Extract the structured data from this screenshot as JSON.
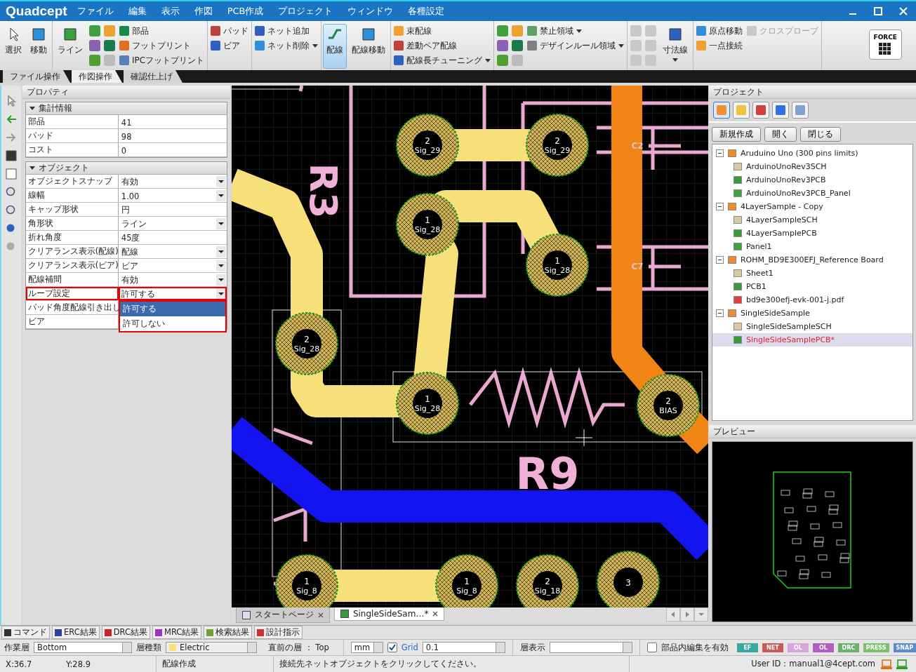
{
  "app": {
    "logo": "Quadcept",
    "menu": [
      "ファイル",
      "編集",
      "表示",
      "作図",
      "PCB作成",
      "プロジェクト",
      "ウィンドウ",
      "各種設定"
    ]
  },
  "ribbon": {
    "groups": [
      {
        "items": [
          {
            "kind": "big",
            "label": "選択",
            "selected": false
          },
          {
            "kind": "big",
            "label": "移動",
            "selected": false
          }
        ]
      },
      {
        "items": [
          {
            "kind": "big",
            "label": "ライン",
            "selected": false
          },
          {
            "kind": "icons"
          },
          {
            "kind": "stack",
            "buttons": [
              {
                "label": "部品",
                "disabled": false
              },
              {
                "label": "フットプリント",
                "disabled": false
              },
              {
                "label": "IPCフットプリント",
                "disabled": false
              }
            ]
          }
        ]
      },
      {
        "items": [
          {
            "kind": "stack",
            "buttons": [
              {
                "label": "パッド",
                "disabled": false
              },
              {
                "label": "ビア",
                "disabled": false
              }
            ]
          }
        ]
      },
      {
        "items": [
          {
            "kind": "stack",
            "buttons": [
              {
                "label": "ネット追加",
                "disabled": false
              },
              {
                "label": "ネット削除",
                "dropdown": true,
                "disabled": false
              }
            ]
          }
        ]
      },
      {
        "items": [
          {
            "kind": "big",
            "label": "配線",
            "selected": true
          },
          {
            "kind": "big",
            "label": "配線移動",
            "selected": false
          }
        ]
      },
      {
        "items": [
          {
            "kind": "stack",
            "buttons": [
              {
                "label": "束配線",
                "disabled": false
              },
              {
                "label": "差動ペア配線",
                "disabled": false
              },
              {
                "label": "配線長チューニング",
                "dropdown": true,
                "disabled": false
              }
            ]
          }
        ]
      },
      {
        "items": [
          {
            "kind": "icons"
          },
          {
            "kind": "stack",
            "buttons": [
              {
                "label": "禁止領域",
                "dropdown": true,
                "disabled": false
              },
              {
                "label": "デザインルール領域",
                "dropdown": true,
                "disabled": false
              }
            ]
          }
        ]
      },
      {
        "items": [
          {
            "kind": "icons"
          },
          {
            "kind": "big",
            "label": "寸法線",
            "selected": false,
            "dropdown": true
          }
        ]
      },
      {
        "items": [
          {
            "kind": "stack",
            "buttons": [
              {
                "label": "原点移動",
                "disabled": false
              },
              {
                "label": "一点接続",
                "disabled": false
              }
            ]
          },
          {
            "kind": "stack",
            "buttons": [
              {
                "label": "クロスプローブ",
                "disabled": true
              }
            ]
          }
        ]
      },
      {
        "items": [
          {
            "kind": "force",
            "label": "FORCE"
          }
        ]
      }
    ]
  },
  "ribbon_tabs": [
    {
      "label": "ファイル操作",
      "selected": false
    },
    {
      "label": "作図操作",
      "selected": true
    },
    {
      "label": "確認仕上げ",
      "selected": false
    }
  ],
  "properties": {
    "title": "プロパティ",
    "sections": [
      {
        "title": "集計情報",
        "expanded": true,
        "rows": [
          {
            "label": "部品",
            "value": "41",
            "highlighted": false
          },
          {
            "label": "パッド",
            "value": "98",
            "highlighted": false
          },
          {
            "label": "コスト",
            "value": "0",
            "highlighted": false
          }
        ]
      },
      {
        "title": "オブジェクト",
        "expanded": true,
        "rows": [
          {
            "label": "オブジェクトスナップ",
            "value": "有効",
            "dropdown": true,
            "highlighted": false
          },
          {
            "label": "線幅",
            "value": "1.00",
            "dropdown": true,
            "highlighted": false
          },
          {
            "label": "キャップ形状",
            "value": "円",
            "highlighted": false
          },
          {
            "label": "角形状",
            "value": "ライン",
            "dropdown": true,
            "highlighted": false
          },
          {
            "label": "折れ角度",
            "value": "45度",
            "highlighted": false
          },
          {
            "label": "クリアランス表示(配線)",
            "value": "配線",
            "dropdown": true,
            "highlighted": false
          },
          {
            "label": "クリアランス表示(ビア)",
            "value": "ビア",
            "dropdown": true,
            "highlighted": false
          },
          {
            "label": "配線補間",
            "value": "有効",
            "dropdown": true,
            "highlighted": false
          },
          {
            "label": "ループ設定",
            "value": "許可する",
            "dropdown": true,
            "highlighted": true,
            "options": [
              {
                "label": "許可する",
                "selected": true
              },
              {
                "label": "許可しない",
                "selected": false
              }
            ]
          },
          {
            "label": "パッド角度配線引き出し",
            "highlighted": false
          },
          {
            "label": "ビア",
            "highlighted": false
          }
        ]
      }
    ]
  },
  "canvas": {
    "pads": [
      {
        "number": "2",
        "net": "Sig_29"
      },
      {
        "number": "2",
        "net": "Sig_29"
      },
      {
        "number": "1",
        "net": "Sig_28"
      },
      {
        "number": "1",
        "net": "Sig_28"
      },
      {
        "number": "2",
        "net": "Sig_28"
      },
      {
        "number": "1",
        "net": "Sig_28"
      },
      {
        "number": "2",
        "net": "BIAS"
      },
      {
        "number": "1",
        "net": "Sig_8"
      },
      {
        "number": "1",
        "net": "Sig_8"
      },
      {
        "number": "2",
        "net": "Sig_18"
      },
      {
        "number": "3"
      }
    ],
    "silk_labels": [
      "C2",
      "C7",
      "R9",
      "R3"
    ]
  },
  "doc_tabs": [
    {
      "label": "スタートページ",
      "selected": false
    },
    {
      "label": "SingleSideSam…*",
      "selected": true
    }
  ],
  "project": {
    "title": "プロジェクト",
    "buttons": [
      "新規作成",
      "開く",
      "閉じる"
    ],
    "tree": [
      {
        "kind": "prj",
        "label": "Aruduino Uno (300 pins limits)",
        "expanded": true,
        "selected": false,
        "children": [
          {
            "kind": "sch",
            "label": "ArduinoUnoRev3SCH",
            "selected": false
          },
          {
            "kind": "pcb",
            "label": "ArduinoUnoRev3PCB",
            "selected": false
          },
          {
            "kind": "panel",
            "label": "ArduinoUnoRev3PCB_Panel",
            "selected": false
          }
        ]
      },
      {
        "kind": "prj",
        "label": "4LayerSample - Copy",
        "expanded": true,
        "selected": false,
        "children": [
          {
            "kind": "sch",
            "label": "4LayerSampleSCH",
            "selected": false
          },
          {
            "kind": "pcb",
            "label": "4LayerSamplePCB",
            "selected": false
          },
          {
            "kind": "panel",
            "label": "Panel1",
            "selected": false
          }
        ]
      },
      {
        "kind": "prj",
        "label": "ROHM_BD9E300EFJ_Reference Board",
        "expanded": true,
        "selected": false,
        "children": [
          {
            "kind": "sch",
            "label": "Sheet1",
            "selected": false
          },
          {
            "kind": "pcb",
            "label": "PCB1",
            "selected": false
          },
          {
            "kind": "pdf",
            "label": "bd9e300efj-evk-001-j.pdf",
            "selected": false
          }
        ]
      },
      {
        "kind": "prj",
        "label": "SingleSideSample",
        "expanded": true,
        "selected": false,
        "children": [
          {
            "kind": "sch",
            "label": "SingleSideSampleSCH",
            "selected": false
          },
          {
            "kind": "pcb",
            "label": "SingleSideSamplePCB*",
            "selected": true
          }
        ]
      }
    ]
  },
  "preview": {
    "title": "プレビュー"
  },
  "bottom_tabs": [
    "コマンド",
    "ERC結果",
    "DRC結果",
    "MRC結果",
    "検索結果",
    "設計指示"
  ],
  "work_bar": {
    "work_layer_label": "作業層",
    "work_layer": "Bottom",
    "layer_type_label": "層種類",
    "layer_type": "Electric",
    "previous_layer": "直前の層 ： Top",
    "unit": "mm",
    "grid_label": "Grid",
    "grid_checked": true,
    "grid_value": "0.1",
    "layer_view_label": "層表示",
    "part_edit_label": "部品内編集を有効",
    "part_edit_checked": false,
    "badges": [
      {
        "label": "EF",
        "color": "#3aa7a0"
      },
      {
        "label": "NET",
        "color": "#c85a5a"
      },
      {
        "label": "OL",
        "color": "#d9a6dc"
      },
      {
        "label": "OL",
        "color": "#b060c0"
      },
      {
        "label": "DRC",
        "color": "#6cb06c"
      },
      {
        "label": "PRESS",
        "color": "#7cbf6c"
      },
      {
        "label": "SNAP",
        "color": "#5a8ad0"
      }
    ]
  },
  "status_bar": {
    "x": "X:36.7",
    "y": "Y:28.9",
    "mode": "配線作成",
    "message": "接続先ネットオブジェクトをクリックしてください。",
    "user": "User ID：manual1@4cept.com"
  }
}
